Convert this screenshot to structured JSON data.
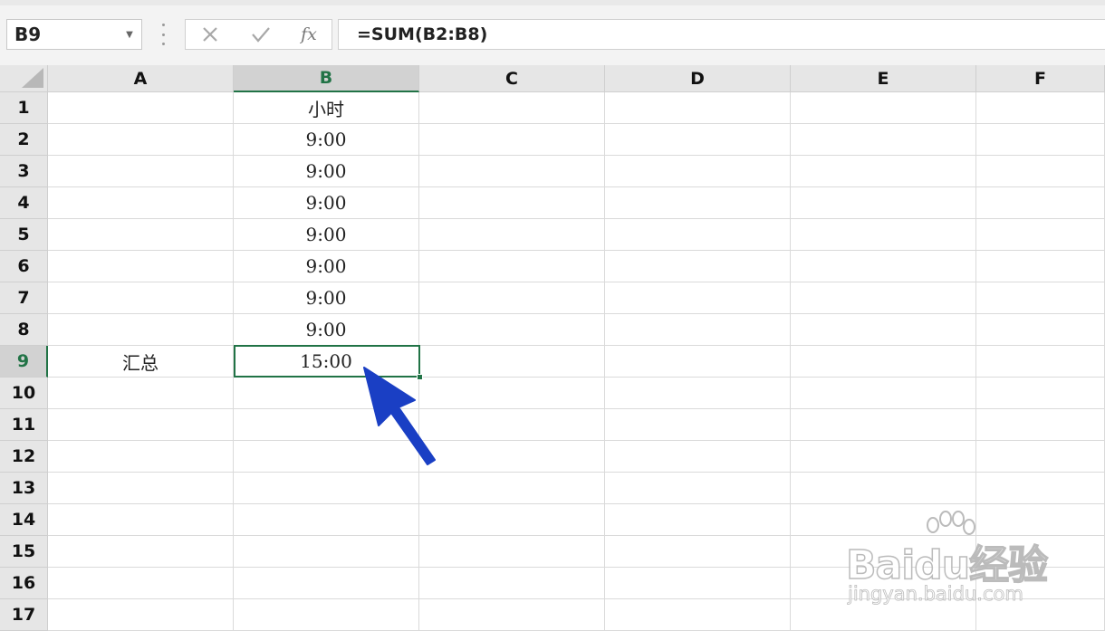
{
  "formula_bar": {
    "name_box": "B9",
    "cancel_icon": "close-icon",
    "enter_icon": "checkmark-icon",
    "function_label": "fx",
    "formula": "=SUM(B2:B8)"
  },
  "columns": [
    "A",
    "B",
    "C",
    "D",
    "E",
    "F"
  ],
  "rows": [
    "1",
    "2",
    "3",
    "4",
    "5",
    "6",
    "7",
    "8",
    "9",
    "10",
    "11",
    "12",
    "13",
    "14",
    "15",
    "16",
    "17"
  ],
  "cells": {
    "B1": "小时",
    "B2": "9:00",
    "B3": "9:00",
    "B4": "9:00",
    "B5": "9:00",
    "B6": "9:00",
    "B7": "9:00",
    "B8": "9:00",
    "A9": "汇总",
    "B9": "15:00"
  },
  "active_cell": "B9",
  "colors": {
    "accent_green": "#217346",
    "arrow_blue": "#1a3fc4"
  },
  "watermark": {
    "brand": "Baidu经验",
    "url": "jingyan.baidu.com"
  }
}
